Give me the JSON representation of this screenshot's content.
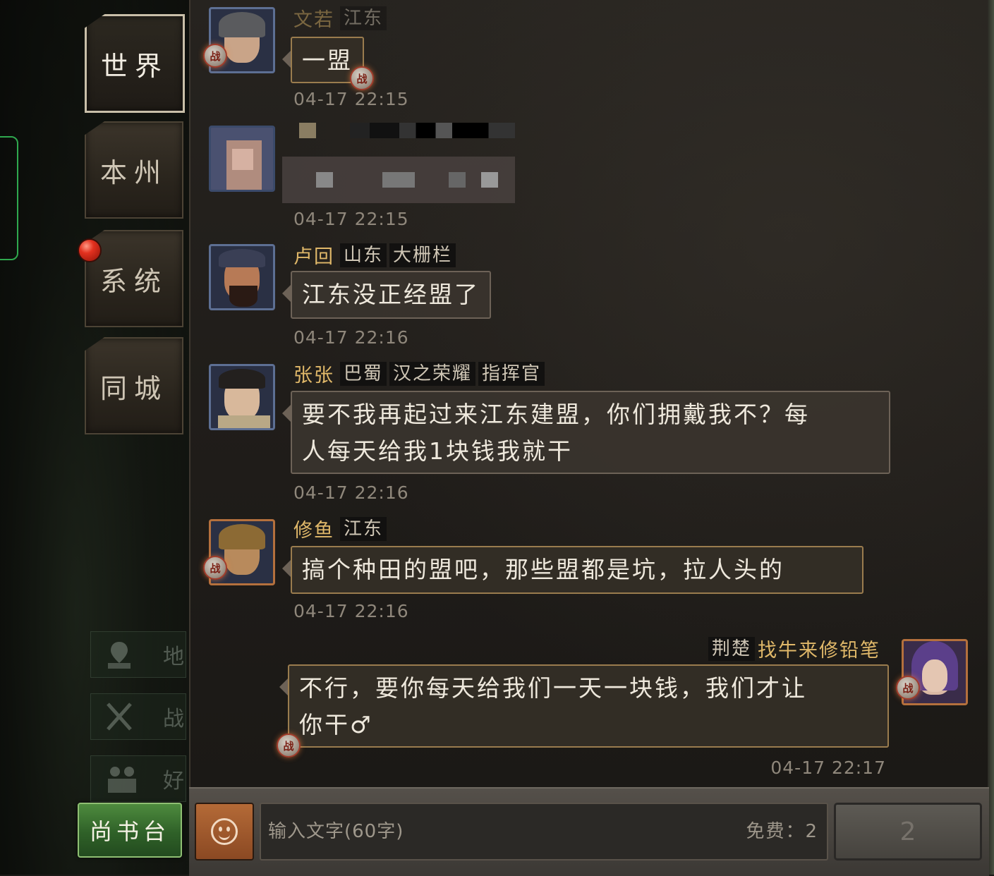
{
  "tabs": [
    {
      "label": "世界",
      "active": true
    },
    {
      "label": "本州",
      "active": false
    },
    {
      "label": "系统",
      "active": false,
      "notification": true
    },
    {
      "label": "同城",
      "active": false
    }
  ],
  "side_shortcuts": [
    {
      "icon": "map-pin-icon",
      "label": "地"
    },
    {
      "icon": "crossed-swords-icon",
      "label": "战"
    },
    {
      "icon": "people-icon",
      "label": "好"
    }
  ],
  "bottom_button": "尚书台",
  "messages": [
    {
      "name": "文若",
      "tags": [
        "江东"
      ],
      "text": "一盟",
      "time": "04-17 22:15",
      "avatar_badge": "战",
      "bubble_badge": "战"
    },
    {
      "name": "",
      "tags": [],
      "text": "",
      "time": "04-17 22:15",
      "pixelated": true
    },
    {
      "name": "卢回",
      "tags": [
        "山东",
        "大栅栏"
      ],
      "text": "江东没正经盟了",
      "time": "04-17 22:16"
    },
    {
      "name": "张张",
      "tags": [
        "巴蜀",
        "汉之荣耀",
        "指挥官"
      ],
      "text_line1": "要不我再起过来江东建盟，你们拥戴我不？每",
      "text_line2": "人每天给我1块钱我就干",
      "time": "04-17 22:16"
    },
    {
      "name": "修鱼",
      "tags": [
        "江东"
      ],
      "text": "搞个种田的盟吧，那些盟都是坑，拉人头的",
      "time": "04-17 22:16",
      "avatar_badge": "战"
    },
    {
      "name": "找牛来修铅笔",
      "tags": [
        "荆楚"
      ],
      "text_line1": "不行，要你每天给我们一天一块钱，我们才让",
      "text_line2": "你干♂",
      "time": "04-17 22:17",
      "own": true,
      "avatar_badge": "战",
      "bubble_badge": "战"
    }
  ],
  "input": {
    "placeholder": "输入文字(60字)",
    "free_label": "免费：2",
    "send_label": "2",
    "emoji_icon": "smiley-icon"
  },
  "colors": {
    "name_gold": "#e0b869",
    "active_tab_border": "#c9bfa9",
    "shangshu_green": "#2f6128",
    "notification_red": "#e3311f"
  }
}
